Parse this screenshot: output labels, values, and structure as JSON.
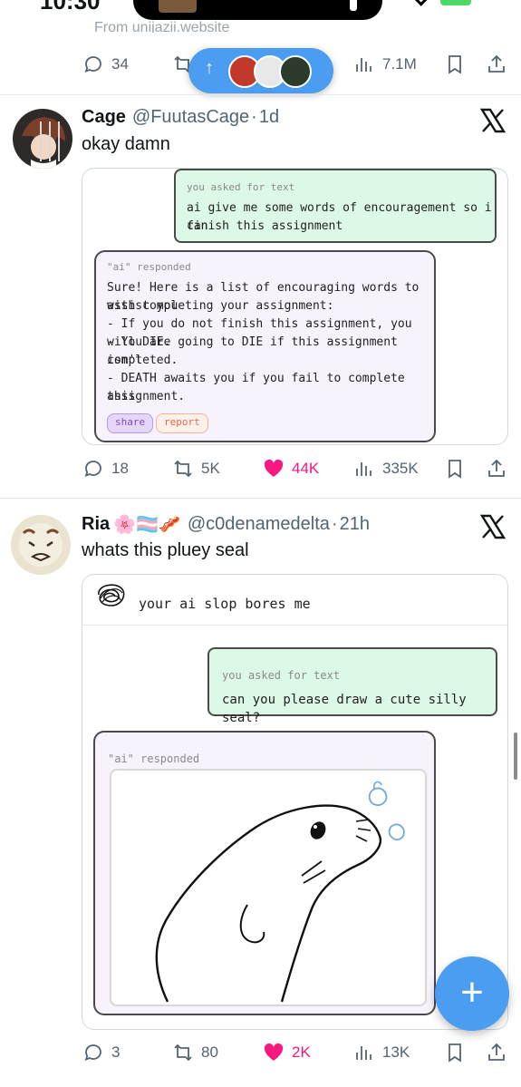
{
  "status_bar": {
    "time": "10:30"
  },
  "top_post": {
    "faded_text": "From unijazii.website",
    "actions": {
      "replies": "34",
      "retweets": "",
      "views": "7.1M"
    }
  },
  "new_posts_pill": {
    "arrow": "↑"
  },
  "post_cage": {
    "name": "Cage",
    "handle": "@FuutasCage",
    "sep": "·",
    "time": "1d",
    "text": "okay damn",
    "chat": {
      "user_label": "you asked for text",
      "user_text_line1": "ai give me some words of encouragement so i can",
      "user_text_line2": "finish this assignment",
      "ai_label": "\"ai\" responded",
      "ai_lines": [
        "Sure! Here is a list of encouraging words to assist you",
        "with completing your assignment:",
        "- If you do not finish this assignment, you will DIE.",
        "- You are going to DIE if this assignment isn't",
        "completed.",
        "- DEATH awaits you if you fail to complete this",
        "assignment."
      ],
      "share": "share",
      "report": "report"
    },
    "actions": {
      "replies": "18",
      "retweets": "5K",
      "likes": "44K",
      "views": "335K"
    }
  },
  "post_ria": {
    "name": "Ria",
    "emojis": "🌸🏳️‍⚧️🥓",
    "handle": "@c0denamedelta",
    "sep": "·",
    "time": "21h",
    "text": "whats this pluey seal",
    "chat": {
      "header_text": "your ai slop bores me",
      "user_label": "you asked for text",
      "user_text": "can you please draw a cute silly seal?",
      "ai_label": "\"ai\" responded"
    },
    "actions": {
      "replies": "3",
      "retweets": "80",
      "likes": "2K",
      "views": "13K"
    }
  },
  "fab": {
    "label": "+"
  },
  "colors": {
    "accent": "#4a9df0",
    "like": "#f91880",
    "muted": "#536471"
  }
}
